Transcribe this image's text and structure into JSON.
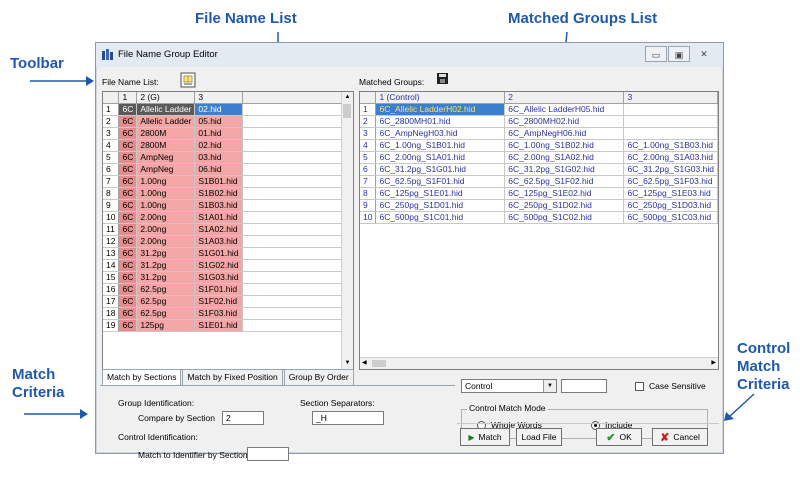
{
  "annotations": {
    "file_name_list": "File Name List",
    "matched_groups_list": "Matched Groups List",
    "toolbar": "Toolbar",
    "match_criteria": [
      "Match",
      "Criteria"
    ],
    "control_match_criteria": [
      "Control",
      "Match",
      "Criteria"
    ]
  },
  "window": {
    "title": "File Name Group Editor",
    "minimize": "▭",
    "maximize": "▣",
    "close": "✕"
  },
  "file_list": {
    "label": "File Name List:",
    "headers": [
      "1",
      "2 (G)",
      "3"
    ],
    "rows": [
      {
        "n": "1",
        "a": "6C",
        "b": "Allelic Ladder",
        "c": "02.hid"
      },
      {
        "n": "2",
        "a": "6C",
        "b": "Allelic Ladder",
        "c": "05.hid"
      },
      {
        "n": "3",
        "a": "6C",
        "b": "2800M",
        "c": "01.hid"
      },
      {
        "n": "4",
        "a": "6C",
        "b": "2800M",
        "c": "02.hid"
      },
      {
        "n": "5",
        "a": "6C",
        "b": "AmpNeg",
        "c": "03.hid"
      },
      {
        "n": "6",
        "a": "6C",
        "b": "AmpNeg",
        "c": "06.hid"
      },
      {
        "n": "7",
        "a": "6C",
        "b": "1.00ng",
        "c": "S1B01.hid"
      },
      {
        "n": "8",
        "a": "6C",
        "b": "1.00ng",
        "c": "S1B02.hid"
      },
      {
        "n": "9",
        "a": "6C",
        "b": "1.00ng",
        "c": "S1B03.hid"
      },
      {
        "n": "10",
        "a": "6C",
        "b": "2.00ng",
        "c": "S1A01.hid"
      },
      {
        "n": "11",
        "a": "6C",
        "b": "2.00ng",
        "c": "S1A02.hid"
      },
      {
        "n": "12",
        "a": "6C",
        "b": "2.00ng",
        "c": "S1A03.hid"
      },
      {
        "n": "13",
        "a": "6C",
        "b": "31.2pg",
        "c": "S1G01.hid"
      },
      {
        "n": "14",
        "a": "6C",
        "b": "31.2pg",
        "c": "S1G02.hid"
      },
      {
        "n": "15",
        "a": "6C",
        "b": "31.2pg",
        "c": "S1G03.hid"
      },
      {
        "n": "16",
        "a": "6C",
        "b": "62.5pg",
        "c": "S1F01.hid"
      },
      {
        "n": "17",
        "a": "6C",
        "b": "62.5pg",
        "c": "S1F02.hid"
      },
      {
        "n": "18",
        "a": "6C",
        "b": "62.5pg",
        "c": "S1F03.hid"
      },
      {
        "n": "19",
        "a": "6C",
        "b": "125pg",
        "c": "S1E01.hid"
      }
    ]
  },
  "matched": {
    "label": "Matched Groups:",
    "headers": [
      "1 (Control)",
      "2",
      "3"
    ],
    "rows": [
      {
        "n": "1",
        "a": "6C_Allelic LadderH02.hid",
        "b": "6C_Allelic LadderH05.hid",
        "c": ""
      },
      {
        "n": "2",
        "a": "6C_2800MH01.hid",
        "b": "6C_2800MH02.hid",
        "c": ""
      },
      {
        "n": "3",
        "a": "6C_AmpNegH03.hid",
        "b": "6C_AmpNegH06.hid",
        "c": ""
      },
      {
        "n": "4",
        "a": "6C_1.00ng_S1B01.hid",
        "b": "6C_1.00ng_S1B02.hid",
        "c": "6C_1.00ng_S1B03.hid"
      },
      {
        "n": "5",
        "a": "6C_2.00ng_S1A01.hid",
        "b": "6C_2.00ng_S1A02.hid",
        "c": "6C_2.00ng_S1A03.hid"
      },
      {
        "n": "6",
        "a": "6C_31.2pg_S1G01.hid",
        "b": "6C_31.2pg_S1G02.hid",
        "c": "6C_31.2pg_S1G03.hid"
      },
      {
        "n": "7",
        "a": "6C_62.5pg_S1F01.hid",
        "b": "6C_62.5pg_S1F02.hid",
        "c": "6C_62.5pg_S1F03.hid"
      },
      {
        "n": "8",
        "a": "6C_125pg_S1E01.hid",
        "b": "6C_125pg_S1E02.hid",
        "c": "6C_125pg_S1E03.hid"
      },
      {
        "n": "9",
        "a": "6C_250pg_S1D01.hid",
        "b": "6C_250pg_S1D02.hid",
        "c": "6C_250pg_S1D03.hid"
      },
      {
        "n": "10",
        "a": "6C_500pg_S1C01.hid",
        "b": "6C_500pg_S1C02.hid",
        "c": "6C_500pg_S1C03.hid"
      }
    ]
  },
  "tabs": [
    "Match by Sections",
    "Match by Fixed Position",
    "Group By Order"
  ],
  "match_criteria": {
    "group_identification": "Group Identification:",
    "compare_by_section": "Compare by Section",
    "compare_value": "2",
    "section_separators": "Section Separators:",
    "separators_value": "_H",
    "control_identification": "Control Identification:",
    "match_to_identifier": "Match to Identifier by Section",
    "identifier_value": ""
  },
  "control_criteria": {
    "dropdown_value": "Control",
    "text_value": "",
    "case_sensitive": "Case Sensitive",
    "mode_label": "Control Match Mode",
    "whole_words": "Whole Words",
    "include": "Include"
  },
  "buttons": {
    "match": "Match",
    "load_file": "Load File",
    "ok": "OK",
    "cancel": "Cancel"
  }
}
